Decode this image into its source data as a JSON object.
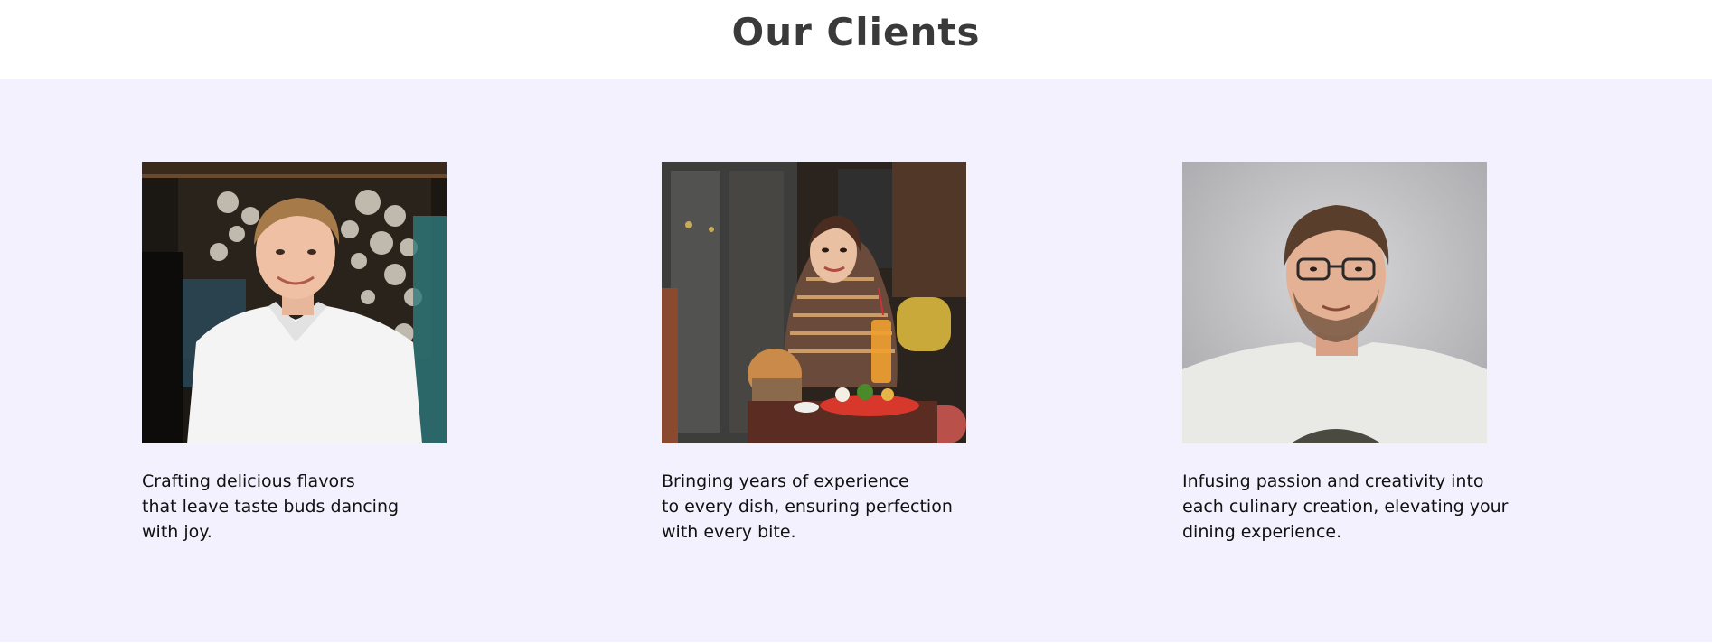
{
  "header": {
    "title": "Our Clients"
  },
  "colors": {
    "title": "#3a3a3a",
    "section_background": "#f2f1fd",
    "text": "#111111"
  },
  "clients": [
    {
      "photo_description_icon": "client-photo-young-man-white-shirt",
      "lines": [
        "Crafting delicious flavors",
        "that leave taste buds dancing",
        "with joy."
      ]
    },
    {
      "photo_description_icon": "client-photo-woman-at-restaurant-table",
      "lines": [
        "Bringing years of experience",
        "to every dish, ensuring perfection",
        "with every bite."
      ]
    },
    {
      "photo_description_icon": "client-photo-man-with-glasses",
      "lines": [
        "Infusing passion and creativity into",
        "each culinary creation, elevating your",
        "dining experience."
      ]
    }
  ]
}
